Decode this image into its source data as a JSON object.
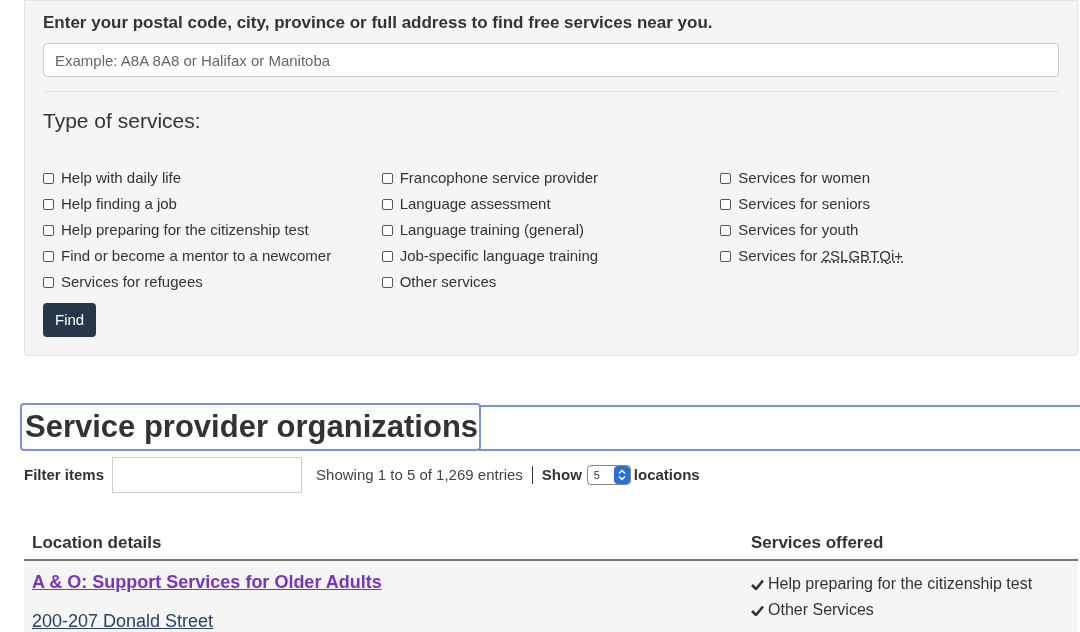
{
  "search_form": {
    "prompt": "Enter your postal code, city, province or full address to find free services near you.",
    "address_field": {
      "placeholder": "Example: A8A 8A8 or Halifax or Manitoba"
    },
    "services_heading": "Type of services:",
    "service_columns": [
      [
        {
          "label": "Help with daily life",
          "checked": false
        },
        {
          "label": "Help finding a job",
          "checked": false
        },
        {
          "label": "Help preparing for the citizenship test",
          "checked": false
        },
        {
          "label": "Find or become a mentor to a newcomer",
          "checked": false
        },
        {
          "label": "Services for refugees",
          "checked": false
        }
      ],
      [
        {
          "label": "Francophone service provider",
          "checked": false
        },
        {
          "label": "Language assessment",
          "checked": false
        },
        {
          "label": "Language training (general)",
          "checked": false
        },
        {
          "label": "Job-specific language training",
          "checked": false
        },
        {
          "label": "Other services",
          "checked": false
        }
      ],
      [
        {
          "label": "Services for women",
          "checked": false
        },
        {
          "label": "Services for seniors",
          "checked": false
        },
        {
          "label": "Services for youth",
          "checked": false
        },
        {
          "label": "Services for ",
          "abbr": "2SLGBTQi+",
          "checked": false
        }
      ]
    ],
    "find_button": "Find"
  },
  "results": {
    "heading": "Service provider organizations",
    "filter_label": "Filter items",
    "summary": "Showing 1 to 5 of 1,269 entries",
    "show_label": "Show",
    "show_value": "5",
    "show_suffix": "locations",
    "table": {
      "columns": [
        "Location details",
        "Services offered"
      ],
      "rows": [
        {
          "name": "A & O: Support Services for Older Adults",
          "address": "200-207 Donald Street",
          "services": [
            "Help preparing for the citizenship test",
            "Other Services"
          ]
        }
      ]
    }
  }
}
